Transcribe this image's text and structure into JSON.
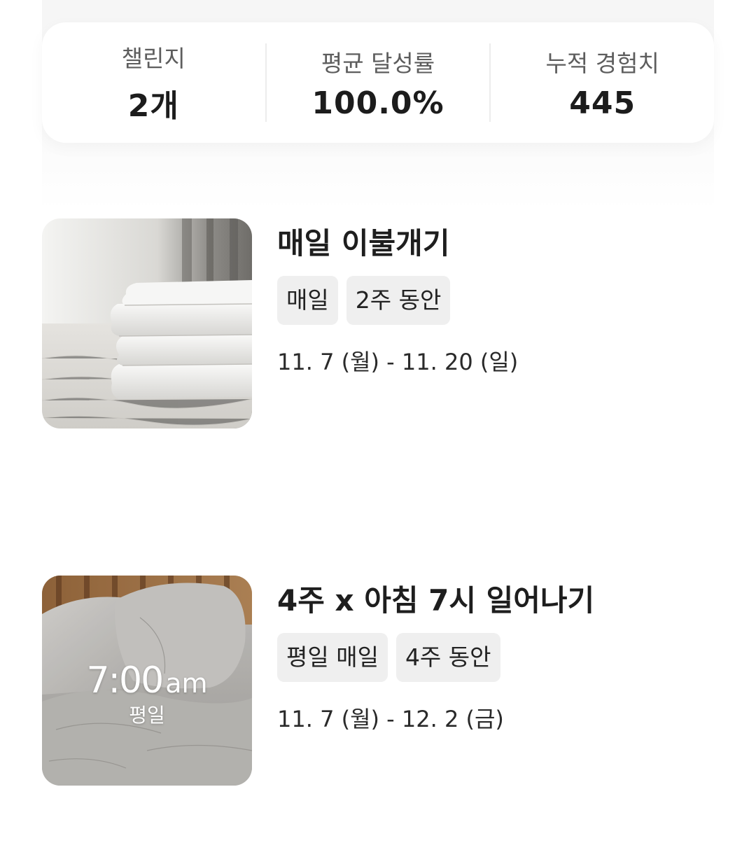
{
  "stats": [
    {
      "label": "챌린지",
      "value": "2개"
    },
    {
      "label": "평균 달성률",
      "value": "100.0%"
    },
    {
      "label": "누적 경험치",
      "value": "445"
    }
  ],
  "challenges": [
    {
      "title": "매일 이불개기",
      "tags": [
        "매일",
        "2주 동안"
      ],
      "dates": "11. 7 (월) - 11. 20 (일)",
      "image_icon": "folded-blanket-photo"
    },
    {
      "title": "4주 x 아침 7시 일어나기",
      "tags": [
        "평일 매일",
        "4주 동안"
      ],
      "dates": "11. 7 (월) - 12. 2 (금)",
      "image_icon": "bed-pillow-alarm-photo",
      "overlay": {
        "time": "7:00",
        "ampm": "am",
        "sub": "평일"
      }
    }
  ],
  "colors": {
    "tag_bg": "#efefef",
    "label": "#5d5d5d",
    "text": "#1c1c1c"
  }
}
